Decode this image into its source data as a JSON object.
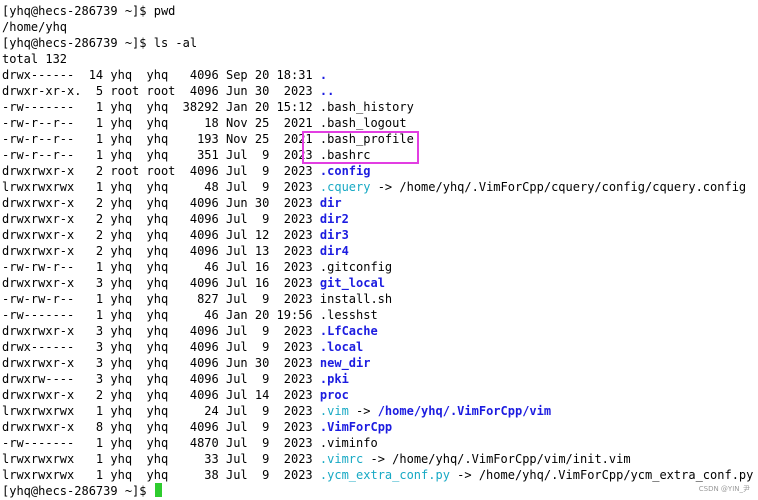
{
  "terminal": {
    "colors": {
      "background": "#ffffff",
      "text": "#000000",
      "directory": "#1c1ce0",
      "symlink": "#17a9c4",
      "cursor": "#2ecc2e",
      "highlight_box": "#e23ee2"
    },
    "lines": [
      [
        {
          "t": "[yhq@hecs-286739 ~]$ pwd"
        }
      ],
      [
        {
          "t": "/home/yhq"
        }
      ],
      [
        {
          "t": "[yhq@hecs-286739 ~]$ ls -al"
        }
      ],
      [
        {
          "t": "total 132"
        }
      ],
      [
        {
          "t": "drwx------  14 yhq  yhq   4096 Sep 20 18:31 "
        },
        {
          "t": ".",
          "c": "dir"
        }
      ],
      [
        {
          "t": "drwxr-xr-x.  5 root root  4096 Jun 30  2023 "
        },
        {
          "t": "..",
          "c": "dir"
        }
      ],
      [
        {
          "t": "-rw-------   1 yhq  yhq  38292 Jan 20 15:12 .bash_history"
        }
      ],
      [
        {
          "t": "-rw-r--r--   1 yhq  yhq     18 Nov 25  2021 .bash_logout"
        }
      ],
      [
        {
          "t": "-rw-r--r--   1 yhq  yhq    193 Nov 25  2021 .bash_profile"
        }
      ],
      [
        {
          "t": "-rw-r--r--   1 yhq  yhq    351 Jul  9  2023 .bashrc"
        }
      ],
      [
        {
          "t": "drwxrwxr-x   2 root root  4096 Jul  9  2023 "
        },
        {
          "t": ".config",
          "c": "dir"
        }
      ],
      [
        {
          "t": "lrwxrwxrwx   1 yhq  yhq     48 Jul  9  2023 "
        },
        {
          "t": ".cquery",
          "c": "link"
        },
        {
          "t": " -> /home/yhq/.VimForCpp/cquery/config/cquery.config"
        }
      ],
      [
        {
          "t": "drwxrwxr-x   2 yhq  yhq   4096 Jun 30  2023 "
        },
        {
          "t": "dir",
          "c": "dir"
        }
      ],
      [
        {
          "t": "drwxrwxr-x   2 yhq  yhq   4096 Jul  9  2023 "
        },
        {
          "t": "dir2",
          "c": "dir"
        }
      ],
      [
        {
          "t": "drwxrwxr-x   2 yhq  yhq   4096 Jul 12  2023 "
        },
        {
          "t": "dir3",
          "c": "dir"
        }
      ],
      [
        {
          "t": "drwxrwxr-x   2 yhq  yhq   4096 Jul 13  2023 "
        },
        {
          "t": "dir4",
          "c": "dir"
        }
      ],
      [
        {
          "t": "-rw-rw-r--   1 yhq  yhq     46 Jul 16  2023 .gitconfig"
        }
      ],
      [
        {
          "t": "drwxrwxr-x   3 yhq  yhq   4096 Jul 16  2023 "
        },
        {
          "t": "git_local",
          "c": "dir"
        }
      ],
      [
        {
          "t": "-rw-rw-r--   1 yhq  yhq    827 Jul  9  2023 install.sh"
        }
      ],
      [
        {
          "t": "-rw-------   1 yhq  yhq     46 Jan 20 19:56 .lesshst"
        }
      ],
      [
        {
          "t": "drwxrwxr-x   3 yhq  yhq   4096 Jul  9  2023 "
        },
        {
          "t": ".LfCache",
          "c": "dir"
        }
      ],
      [
        {
          "t": "drwx------   3 yhq  yhq   4096 Jul  9  2023 "
        },
        {
          "t": ".local",
          "c": "dir"
        }
      ],
      [
        {
          "t": "drwxrwxr-x   3 yhq  yhq   4096 Jun 30  2023 "
        },
        {
          "t": "new_dir",
          "c": "dir"
        }
      ],
      [
        {
          "t": "drwxrw----   3 yhq  yhq   4096 Jul  9  2023 "
        },
        {
          "t": ".pki",
          "c": "dir"
        }
      ],
      [
        {
          "t": "drwxrwxr-x   2 yhq  yhq   4096 Jul 14  2023 "
        },
        {
          "t": "proc",
          "c": "dir"
        }
      ],
      [
        {
          "t": "lrwxrwxrwx   1 yhq  yhq     24 Jul  9  2023 "
        },
        {
          "t": ".vim",
          "c": "link"
        },
        {
          "t": " -> "
        },
        {
          "t": "/home/yhq/.VimForCpp/vim",
          "c": "dir"
        }
      ],
      [
        {
          "t": "drwxrwxr-x   8 yhq  yhq   4096 Jul  9  2023 "
        },
        {
          "t": ".VimForCpp",
          "c": "dir"
        }
      ],
      [
        {
          "t": "-rw-------   1 yhq  yhq   4870 Jul  9  2023 .viminfo"
        }
      ],
      [
        {
          "t": "lrwxrwxrwx   1 yhq  yhq     33 Jul  9  2023 "
        },
        {
          "t": ".vimrc",
          "c": "link"
        },
        {
          "t": " -> /home/yhq/.VimForCpp/vim/init.vim"
        }
      ],
      [
        {
          "t": "lrwxrwxrwx   1 yhq  yhq     38 Jul  9  2023 "
        },
        {
          "t": ".ycm_extra_conf.py",
          "c": "link"
        },
        {
          "t": " -> /home/yhq/.VimForCpp/ycm_extra_conf.py"
        }
      ],
      [
        {
          "t": "[yhq@hecs-286739 ~]$ "
        }
      ]
    ]
  },
  "watermark": "CSDN @YIN_尹"
}
